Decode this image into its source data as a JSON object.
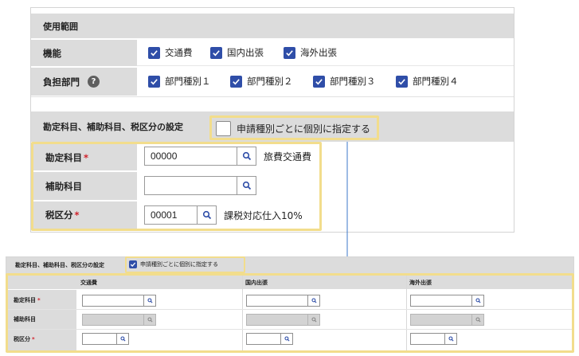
{
  "usage": {
    "header": "使用範囲",
    "function_label": "機能",
    "functions": [
      "交通費",
      "国内出張",
      "海外出張"
    ],
    "department_label": "負担部門",
    "help_icon": "?",
    "departments": [
      "部門種別１",
      "部門種別２",
      "部門種別３",
      "部門種別４"
    ]
  },
  "accounts": {
    "header": "勘定科目、補助科目、税区分の設定",
    "per_type_label": "申請種別ごとに個別に指定する",
    "required_mark": "*",
    "account_label": "勘定科目",
    "account_value": "00000",
    "account_name": "旅費交通費",
    "sub_label": "補助科目",
    "sub_value": "",
    "tax_label": "税区分",
    "tax_value": "00001",
    "tax_name": "課税対応仕入10%"
  },
  "detail": {
    "header": "勘定科目、補助科目、税区分の設定",
    "per_type_label": "申請種別ごとに個別に指定する",
    "columns": [
      "交通費",
      "国内出張",
      "海外出張"
    ],
    "rows": [
      "勘定科目",
      "補助科目",
      "税区分"
    ],
    "required_mark": "*"
  },
  "colors": {
    "accent": "#2f4ea8",
    "highlight": "#f2dd8c",
    "connector": "#3b77c8",
    "label_bg": "#dcdcdc",
    "required": "#d0202a"
  }
}
